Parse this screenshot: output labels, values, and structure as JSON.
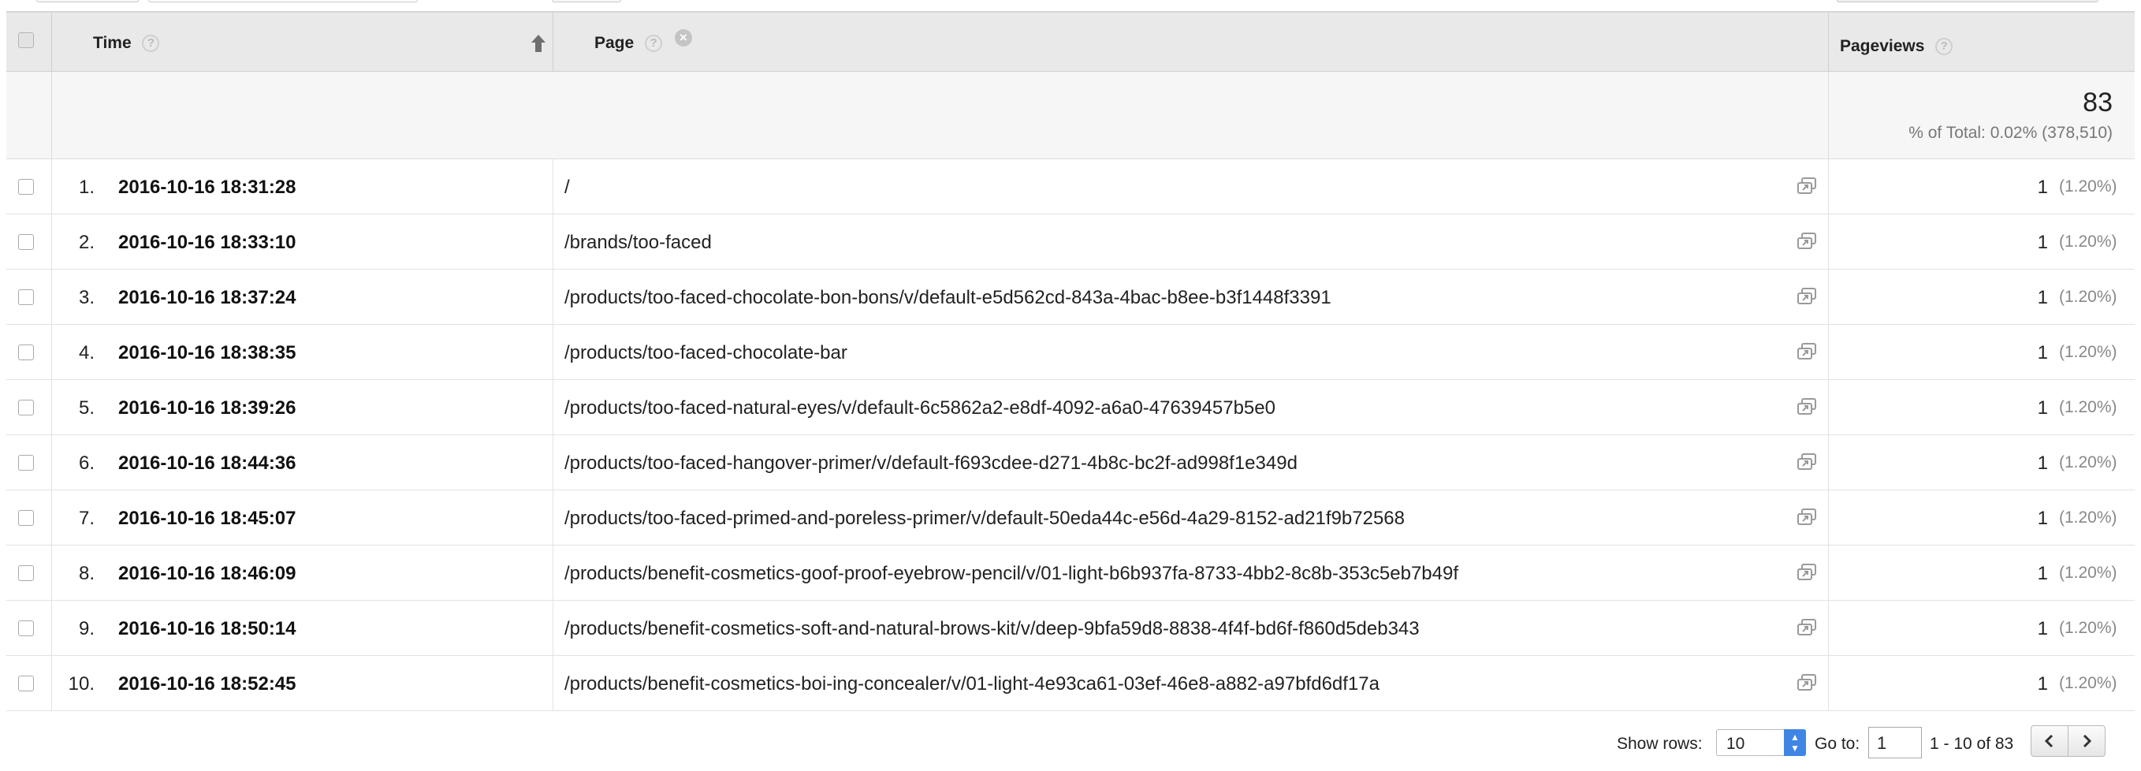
{
  "header": {
    "time_label": "Time",
    "page_label": "Page",
    "pageviews_label": "Pageviews",
    "help_glyph": "?",
    "clear_glyph": "×",
    "sort_icon": "arrow-up-icon"
  },
  "totals": {
    "pageviews": "83",
    "pct_of_total": "% of Total: 0.02% (378,510)"
  },
  "rows": [
    {
      "num": "1.",
      "time": "2016-10-16 18:31:28",
      "page": "/",
      "pageviews": "1",
      "pct": "(1.20%)"
    },
    {
      "num": "2.",
      "time": "2016-10-16 18:33:10",
      "page": "/brands/too-faced",
      "pageviews": "1",
      "pct": "(1.20%)"
    },
    {
      "num": "3.",
      "time": "2016-10-16 18:37:24",
      "page": "/products/too-faced-chocolate-bon-bons/v/default-e5d562cd-843a-4bac-b8ee-b3f1448f3391",
      "pageviews": "1",
      "pct": "(1.20%)"
    },
    {
      "num": "4.",
      "time": "2016-10-16 18:38:35",
      "page": "/products/too-faced-chocolate-bar",
      "pageviews": "1",
      "pct": "(1.20%)"
    },
    {
      "num": "5.",
      "time": "2016-10-16 18:39:26",
      "page": "/products/too-faced-natural-eyes/v/default-6c5862a2-e8df-4092-a6a0-47639457b5e0",
      "pageviews": "1",
      "pct": "(1.20%)"
    },
    {
      "num": "6.",
      "time": "2016-10-16 18:44:36",
      "page": "/products/too-faced-hangover-primer/v/default-f693cdee-d271-4b8c-bc2f-ad998f1e349d",
      "pageviews": "1",
      "pct": "(1.20%)"
    },
    {
      "num": "7.",
      "time": "2016-10-16 18:45:07",
      "page": "/products/too-faced-primed-and-poreless-primer/v/default-50eda44c-e56d-4a29-8152-ad21f9b72568",
      "pageviews": "1",
      "pct": "(1.20%)"
    },
    {
      "num": "8.",
      "time": "2016-10-16 18:46:09",
      "page": "/products/benefit-cosmetics-goof-proof-eyebrow-pencil/v/01-light-b6b937fa-8733-4bb2-8c8b-353c5eb7b49f",
      "pageviews": "1",
      "pct": "(1.20%)"
    },
    {
      "num": "9.",
      "time": "2016-10-16 18:50:14",
      "page": "/products/benefit-cosmetics-soft-and-natural-brows-kit/v/deep-9bfa59d8-8838-4f4f-bd6f-f860d5deb343",
      "pageviews": "1",
      "pct": "(1.20%)"
    },
    {
      "num": "10.",
      "time": "2016-10-16 18:52:45",
      "page": "/products/benefit-cosmetics-boi-ing-concealer/v/01-light-4e93ca61-03ef-46e8-a882-a97bfd6df17a",
      "pageviews": "1",
      "pct": "(1.20%)"
    }
  ],
  "footer": {
    "show_rows_label": "Show rows:",
    "show_rows_value": "10",
    "goto_label": "Go to:",
    "goto_value": "1",
    "range_text": "1 - 10 of 83"
  },
  "colors": {
    "accent": "#3f86e4",
    "header_bg": "#e9e9e9"
  }
}
